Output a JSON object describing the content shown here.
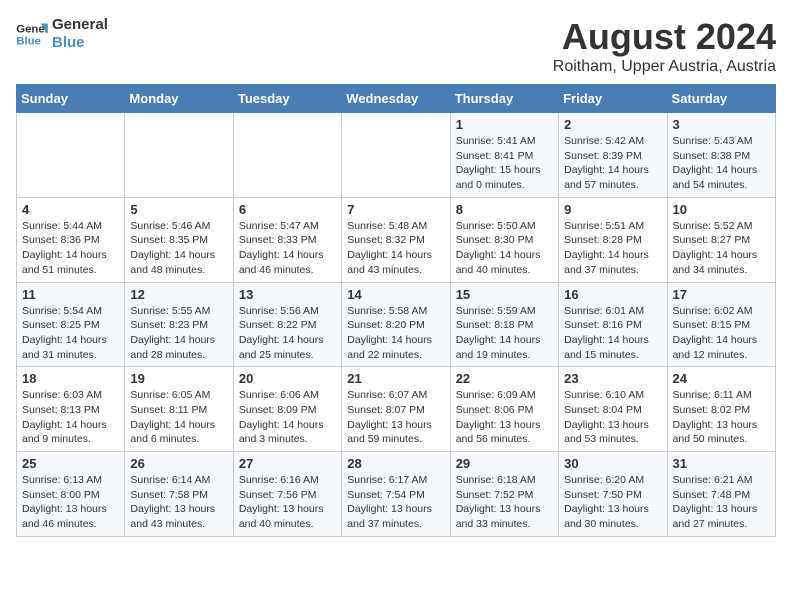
{
  "header": {
    "logo_line1": "General",
    "logo_line2": "Blue",
    "month_year": "August 2024",
    "location": "Roitham, Upper Austria, Austria"
  },
  "weekdays": [
    "Sunday",
    "Monday",
    "Tuesday",
    "Wednesday",
    "Thursday",
    "Friday",
    "Saturday"
  ],
  "weeks": [
    [
      {
        "day": "",
        "sunrise": "",
        "sunset": "",
        "daylight": ""
      },
      {
        "day": "",
        "sunrise": "",
        "sunset": "",
        "daylight": ""
      },
      {
        "day": "",
        "sunrise": "",
        "sunset": "",
        "daylight": ""
      },
      {
        "day": "",
        "sunrise": "",
        "sunset": "",
        "daylight": ""
      },
      {
        "day": "1",
        "sunrise": "Sunrise: 5:41 AM",
        "sunset": "Sunset: 8:41 PM",
        "daylight": "Daylight: 15 hours and 0 minutes."
      },
      {
        "day": "2",
        "sunrise": "Sunrise: 5:42 AM",
        "sunset": "Sunset: 8:39 PM",
        "daylight": "Daylight: 14 hours and 57 minutes."
      },
      {
        "day": "3",
        "sunrise": "Sunrise: 5:43 AM",
        "sunset": "Sunset: 8:38 PM",
        "daylight": "Daylight: 14 hours and 54 minutes."
      }
    ],
    [
      {
        "day": "4",
        "sunrise": "Sunrise: 5:44 AM",
        "sunset": "Sunset: 8:36 PM",
        "daylight": "Daylight: 14 hours and 51 minutes."
      },
      {
        "day": "5",
        "sunrise": "Sunrise: 5:46 AM",
        "sunset": "Sunset: 8:35 PM",
        "daylight": "Daylight: 14 hours and 48 minutes."
      },
      {
        "day": "6",
        "sunrise": "Sunrise: 5:47 AM",
        "sunset": "Sunset: 8:33 PM",
        "daylight": "Daylight: 14 hours and 46 minutes."
      },
      {
        "day": "7",
        "sunrise": "Sunrise: 5:48 AM",
        "sunset": "Sunset: 8:32 PM",
        "daylight": "Daylight: 14 hours and 43 minutes."
      },
      {
        "day": "8",
        "sunrise": "Sunrise: 5:50 AM",
        "sunset": "Sunset: 8:30 PM",
        "daylight": "Daylight: 14 hours and 40 minutes."
      },
      {
        "day": "9",
        "sunrise": "Sunrise: 5:51 AM",
        "sunset": "Sunset: 8:28 PM",
        "daylight": "Daylight: 14 hours and 37 minutes."
      },
      {
        "day": "10",
        "sunrise": "Sunrise: 5:52 AM",
        "sunset": "Sunset: 8:27 PM",
        "daylight": "Daylight: 14 hours and 34 minutes."
      }
    ],
    [
      {
        "day": "11",
        "sunrise": "Sunrise: 5:54 AM",
        "sunset": "Sunset: 8:25 PM",
        "daylight": "Daylight: 14 hours and 31 minutes."
      },
      {
        "day": "12",
        "sunrise": "Sunrise: 5:55 AM",
        "sunset": "Sunset: 8:23 PM",
        "daylight": "Daylight: 14 hours and 28 minutes."
      },
      {
        "day": "13",
        "sunrise": "Sunrise: 5:56 AM",
        "sunset": "Sunset: 8:22 PM",
        "daylight": "Daylight: 14 hours and 25 minutes."
      },
      {
        "day": "14",
        "sunrise": "Sunrise: 5:58 AM",
        "sunset": "Sunset: 8:20 PM",
        "daylight": "Daylight: 14 hours and 22 minutes."
      },
      {
        "day": "15",
        "sunrise": "Sunrise: 5:59 AM",
        "sunset": "Sunset: 8:18 PM",
        "daylight": "Daylight: 14 hours and 19 minutes."
      },
      {
        "day": "16",
        "sunrise": "Sunrise: 6:01 AM",
        "sunset": "Sunset: 8:16 PM",
        "daylight": "Daylight: 14 hours and 15 minutes."
      },
      {
        "day": "17",
        "sunrise": "Sunrise: 6:02 AM",
        "sunset": "Sunset: 8:15 PM",
        "daylight": "Daylight: 14 hours and 12 minutes."
      }
    ],
    [
      {
        "day": "18",
        "sunrise": "Sunrise: 6:03 AM",
        "sunset": "Sunset: 8:13 PM",
        "daylight": "Daylight: 14 hours and 9 minutes."
      },
      {
        "day": "19",
        "sunrise": "Sunrise: 6:05 AM",
        "sunset": "Sunset: 8:11 PM",
        "daylight": "Daylight: 14 hours and 6 minutes."
      },
      {
        "day": "20",
        "sunrise": "Sunrise: 6:06 AM",
        "sunset": "Sunset: 8:09 PM",
        "daylight": "Daylight: 14 hours and 3 minutes."
      },
      {
        "day": "21",
        "sunrise": "Sunrise: 6:07 AM",
        "sunset": "Sunset: 8:07 PM",
        "daylight": "Daylight: 13 hours and 59 minutes."
      },
      {
        "day": "22",
        "sunrise": "Sunrise: 6:09 AM",
        "sunset": "Sunset: 8:06 PM",
        "daylight": "Daylight: 13 hours and 56 minutes."
      },
      {
        "day": "23",
        "sunrise": "Sunrise: 6:10 AM",
        "sunset": "Sunset: 8:04 PM",
        "daylight": "Daylight: 13 hours and 53 minutes."
      },
      {
        "day": "24",
        "sunrise": "Sunrise: 6:11 AM",
        "sunset": "Sunset: 8:02 PM",
        "daylight": "Daylight: 13 hours and 50 minutes."
      }
    ],
    [
      {
        "day": "25",
        "sunrise": "Sunrise: 6:13 AM",
        "sunset": "Sunset: 8:00 PM",
        "daylight": "Daylight: 13 hours and 46 minutes."
      },
      {
        "day": "26",
        "sunrise": "Sunrise: 6:14 AM",
        "sunset": "Sunset: 7:58 PM",
        "daylight": "Daylight: 13 hours and 43 minutes."
      },
      {
        "day": "27",
        "sunrise": "Sunrise: 6:16 AM",
        "sunset": "Sunset: 7:56 PM",
        "daylight": "Daylight: 13 hours and 40 minutes."
      },
      {
        "day": "28",
        "sunrise": "Sunrise: 6:17 AM",
        "sunset": "Sunset: 7:54 PM",
        "daylight": "Daylight: 13 hours and 37 minutes."
      },
      {
        "day": "29",
        "sunrise": "Sunrise: 6:18 AM",
        "sunset": "Sunset: 7:52 PM",
        "daylight": "Daylight: 13 hours and 33 minutes."
      },
      {
        "day": "30",
        "sunrise": "Sunrise: 6:20 AM",
        "sunset": "Sunset: 7:50 PM",
        "daylight": "Daylight: 13 hours and 30 minutes."
      },
      {
        "day": "31",
        "sunrise": "Sunrise: 6:21 AM",
        "sunset": "Sunset: 7:48 PM",
        "daylight": "Daylight: 13 hours and 27 minutes."
      }
    ]
  ]
}
